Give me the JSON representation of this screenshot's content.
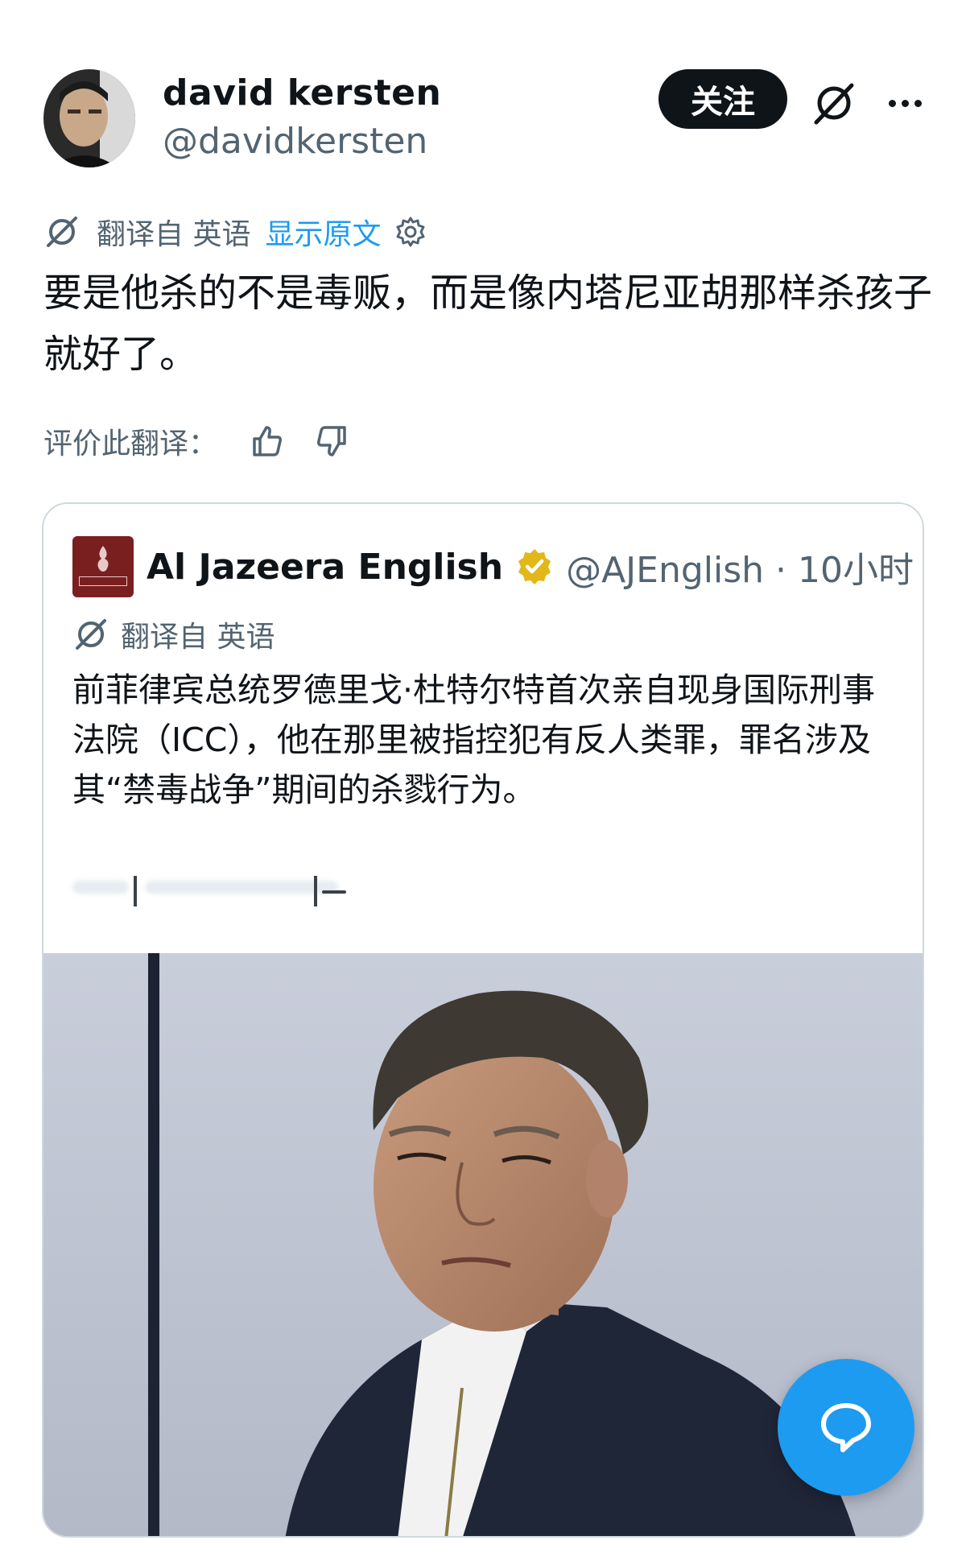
{
  "author": {
    "name": "david kersten",
    "handle": "@davidkersten",
    "follow_label": "关注"
  },
  "translation": {
    "source_label": "翻译自 英语",
    "show_original": "显示原文"
  },
  "tweet": {
    "text": "要是他杀的不是毒贩，而是像内塔尼亚胡那样杀孩子就好了。"
  },
  "rating": {
    "label": "评价此翻译："
  },
  "quoted_tweet": {
    "name": "Al Jazeera English",
    "handle_time": "@AJEnglish · 10小时",
    "translate_label": "翻译自 英语",
    "text": "前菲律宾总统罗德里戈·杜特尔特首次亲自现身国际刑事法院（ICC），他在那里被指控犯有反人类罪，罪名涉及其“禁毒战争”期间的杀戮行为。"
  },
  "icons": {
    "grok": "grok-icon",
    "more": "more-icon",
    "translate": "translate-icon",
    "settings": "gear-icon",
    "thumbs_up": "thumbs-up-icon",
    "thumbs_down": "thumbs-down-icon",
    "verified": "verified-badge-icon",
    "compose": "compose-reply-icon"
  },
  "colors": {
    "accent": "#1d9bf0",
    "text": "#0f1419",
    "secondary_text": "#536471",
    "verified_gold": "#e2b719",
    "aj_brand": "#7a1f1f"
  }
}
